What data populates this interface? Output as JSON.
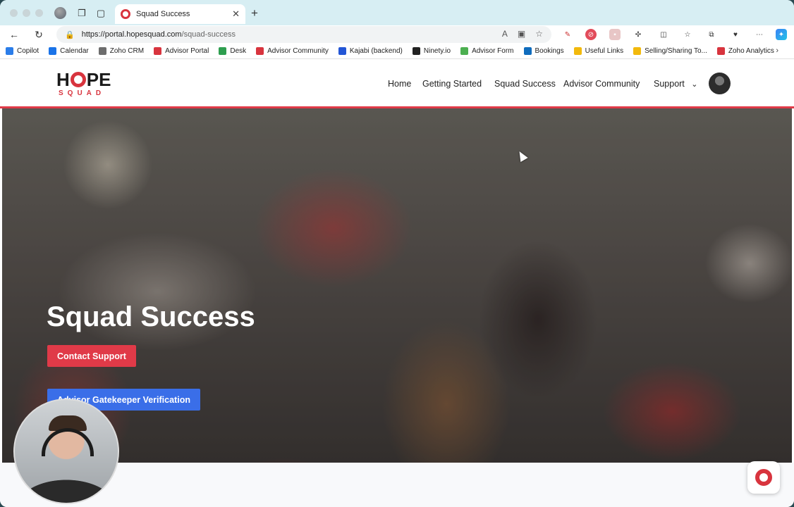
{
  "browser": {
    "tab_title": "Squad Success",
    "url_host": "https://portal.hopesquad.com",
    "url_path": "/squad-success"
  },
  "bookmarks": [
    {
      "label": "Copilot",
      "color": "#2b7de9"
    },
    {
      "label": "Calendar",
      "color": "#1a73e8"
    },
    {
      "label": "Zoho CRM",
      "color": "#6d6d6d"
    },
    {
      "label": "Advisor Portal",
      "color": "#d8343e"
    },
    {
      "label": "Desk",
      "color": "#2e9e4f"
    },
    {
      "label": "Advisor Community",
      "color": "#d8343e"
    },
    {
      "label": "Kajabi (backend)",
      "color": "#2356d6"
    },
    {
      "label": "Ninety.io",
      "color": "#222222"
    },
    {
      "label": "Advisor Form",
      "color": "#4caf50"
    },
    {
      "label": "Bookings",
      "color": "#0f6cbd"
    },
    {
      "label": "Useful Links",
      "color": "#f2b90c"
    },
    {
      "label": "Selling/Sharing To...",
      "color": "#f2b90c"
    },
    {
      "label": "Zoho Analytics",
      "color": "#d8343e"
    }
  ],
  "site": {
    "logo_top_left": "H",
    "logo_top_right": "PE",
    "logo_bottom": "SQUAD",
    "nav": {
      "home": "Home",
      "getting_started": "Getting Started",
      "squad_success": "Squad Success",
      "advisor_community": "Advisor Community",
      "support": "Support"
    }
  },
  "hero": {
    "title": "Squad Success",
    "contact_button": "Contact Support",
    "verify_button": "Advisor Gatekeeper Verification"
  },
  "colors": {
    "brand_red": "#e03a48",
    "brand_blue": "#3a6ee8"
  }
}
